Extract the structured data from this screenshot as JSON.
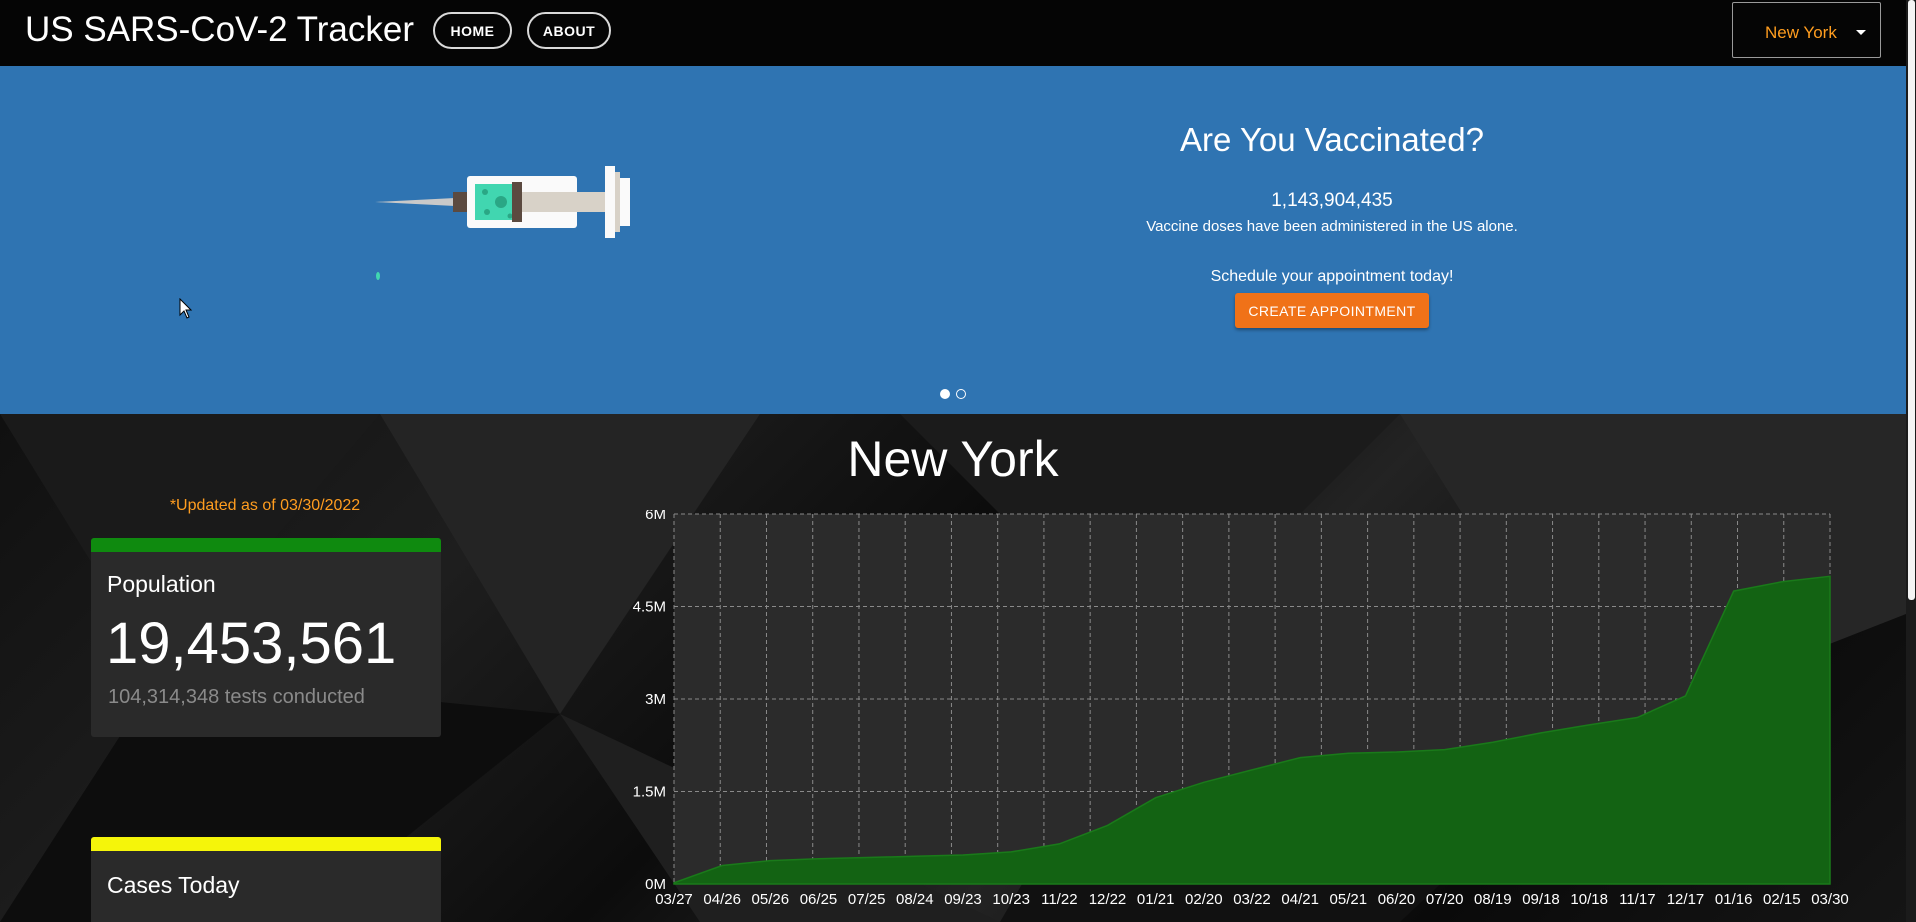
{
  "nav": {
    "brand": "US SARS-CoV-2 Tracker",
    "home": "HOME",
    "about": "ABOUT",
    "state_selected": "New York"
  },
  "carousel": {
    "title": "Are You Vaccinated?",
    "doses": "1,143,904,435",
    "doses_desc": "Vaccine doses have been administered in the US alone.",
    "schedule": "Schedule your appointment today!",
    "button": "CREATE APPOINTMENT",
    "slide_count": 2,
    "active_slide": 1
  },
  "dashboard": {
    "state_title": "New York",
    "updated": "*Updated as of 03/30/2022",
    "population": {
      "label": "Population",
      "value": "19,453,561",
      "tests": "104,314,348 tests conducted",
      "color": "#0f8a0f"
    },
    "cases_today": {
      "label": "Cases Today",
      "color": "#f5f50a"
    }
  },
  "colors": {
    "nav_bg": "#050505",
    "carousel_bg": "#2f74b2",
    "accent_orange": "#ff9d1f",
    "button_orange": "#f07218",
    "area_fill": "#136313"
  },
  "chart_data": {
    "type": "area",
    "x": [
      "03/27",
      "04/26",
      "05/26",
      "06/25",
      "07/25",
      "08/24",
      "09/23",
      "10/23",
      "11/22",
      "12/22",
      "01/21",
      "02/20",
      "03/22",
      "04/21",
      "05/21",
      "06/20",
      "07/20",
      "08/19",
      "09/18",
      "10/18",
      "11/17",
      "12/17",
      "01/16",
      "02/15",
      "03/30"
    ],
    "series": [
      {
        "values": [
          0.02,
          0.3,
          0.38,
          0.41,
          0.43,
          0.45,
          0.47,
          0.52,
          0.65,
          0.95,
          1.4,
          1.65,
          1.85,
          2.05,
          2.12,
          2.14,
          2.18,
          2.3,
          2.45,
          2.58,
          2.7,
          3.05,
          4.75,
          4.9,
          4.99
        ]
      }
    ],
    "y_unit": "M",
    "ylim": [
      0,
      6
    ],
    "yticks": [
      "0M",
      "1.5M",
      "3M",
      "4.5M",
      "6M"
    ],
    "grid": true
  }
}
